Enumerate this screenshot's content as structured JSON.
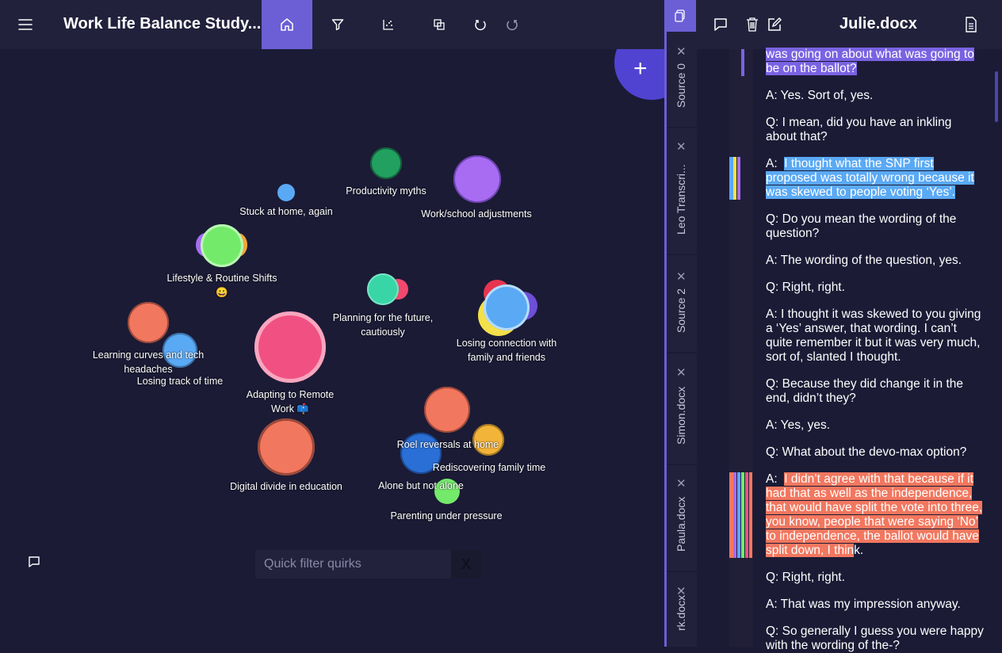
{
  "app": {
    "title": "Work Life Balance Study...",
    "colors": {
      "accent": "#6c5fd6",
      "background": "#1b1b36",
      "bar": "#22213c"
    }
  },
  "toolbar": {
    "icons": [
      "menu-icon",
      "home-icon",
      "filter-icon",
      "scatter-icon",
      "copy-icon",
      "undo-icon",
      "redo-icon"
    ]
  },
  "canvas": {
    "add_button": "+",
    "quirks": [
      {
        "label": "Productivity myths"
      },
      {
        "label": "Stuck at home, again"
      },
      {
        "label": "Work/school adjustments"
      },
      {
        "label": "Lifestyle & Routine Shifts"
      },
      {
        "label": "😀"
      },
      {
        "label": "Planning for the future,"
      },
      {
        "label": "cautiously"
      },
      {
        "label": "Losing connection with"
      },
      {
        "label": "family and friends"
      },
      {
        "label": "Learning curves and tech"
      },
      {
        "label": "headaches"
      },
      {
        "label": "Losing track of time"
      },
      {
        "label": "Adapting to Remote"
      },
      {
        "label": "Work 📫"
      },
      {
        "label": "Roel reversals at home"
      },
      {
        "label": "Rediscovering family time"
      },
      {
        "label": "Digital divide in education"
      },
      {
        "label": "Alone but not alone"
      },
      {
        "label": "Parenting under pressure"
      }
    ],
    "filter_placeholder": "Quick filter quirks",
    "filter_clear": "X"
  },
  "sources": {
    "tabs": [
      {
        "label": "Source 0",
        "close": "✕"
      },
      {
        "label": "Leo Transcri...",
        "close": "✕"
      },
      {
        "label": "Source 2",
        "close": "✕"
      },
      {
        "label": "Simon.docx",
        "close": "✕"
      },
      {
        "label": "Paula.docx",
        "close": "✕"
      },
      {
        "label": "rk.docx",
        "close": "✕"
      }
    ]
  },
  "document": {
    "title": "Julie.docx",
    "paragraphs": [
      {
        "text": "was going on about what was going to be on the ballot?"
      },
      {
        "text": "A:  Yes.  Sort of, yes."
      },
      {
        "text": "Q:  I mean, did you have an inkling about that?"
      },
      {
        "prefix": "A:  ",
        "text": "I thought what the SNP first proposed was totally wrong because it was skewed to people voting ‘Yes’."
      },
      {
        "text": "Q:  Do you mean the wording of the question?"
      },
      {
        "text": "A:  The wording of the question, yes."
      },
      {
        "text": "Q:  Right, right."
      },
      {
        "text": "A:  I thought it was skewed to you giving a ‘Yes’ answer, that wording. I can’t quite remember it but it was very much, sort of, slanted I thought."
      },
      {
        "text": "Q:  Because they did change it in the end, didn’t they?"
      },
      {
        "text": "A:  Yes, yes."
      },
      {
        "text": "Q:  What about the devo-max option?"
      },
      {
        "prefix": "A:  ",
        "text": "I didn’t agree with that because if it had that as well as the independence, that would have split the vote into three, you know, people that were saying ‘No’ to independence, the ballot would have split down, I thin",
        "suffix": "k."
      },
      {
        "text": "Q:  Right, right."
      },
      {
        "text": "A:  That was my impression anyway."
      },
      {
        "text": "Q:  So generally I guess you were happy with the wording of the-?"
      }
    ]
  }
}
